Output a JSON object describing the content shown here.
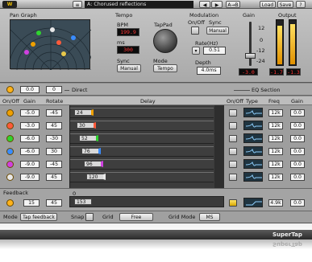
{
  "titlebar": {
    "preset": "A: Chorused reflections",
    "ab_label": "A→B",
    "load_label": "Load",
    "save_label": "Save",
    "help_label": "?"
  },
  "pan_graph": {
    "label": "Pan Graph"
  },
  "tempo": {
    "label": "Tempo",
    "bpm_label": "BPM",
    "bpm_value": "199.9",
    "ms_label": "ms",
    "ms_value": "300",
    "sync_label": "Sync",
    "sync_value": "Manual",
    "tap_label": "TapPad",
    "mode_label": "Mode",
    "mode_value": "Tempo"
  },
  "modulation": {
    "label": "Modulation",
    "onoff_label": "On/Off",
    "sync_label": "Sync",
    "sync_value": "Manual",
    "rate_label": "Rate(Hz)",
    "rate_value": "0.51",
    "depth_label": "Depth",
    "depth_value": "4.0ms"
  },
  "gain": {
    "label": "Gain",
    "scale": [
      "12",
      "0",
      "-12",
      "-24"
    ],
    "value": "-3.0"
  },
  "output": {
    "label": "Output",
    "left": "-1.7",
    "right": "-1.3"
  },
  "direct": {
    "label": "Direct",
    "gain": "0.0",
    "rotate": "0"
  },
  "eq_section": {
    "label": "EQ Section"
  },
  "headers": {
    "onoff": "On/Off",
    "gain": "Gain",
    "rotate": "Rotate",
    "delay": "Delay",
    "eq_onoff": "On/Off",
    "type": "Type",
    "freq": "Freq",
    "eq_gain": "Gain"
  },
  "taps": [
    {
      "gain": "-5.0",
      "rotate": "-45",
      "delay": "24",
      "freq": "12k",
      "eqgain": "0.0"
    },
    {
      "gain": "-3.0",
      "rotate": "45",
      "delay": "30",
      "freq": "12k",
      "eqgain": "0.0"
    },
    {
      "gain": "-6.0",
      "rotate": "-30",
      "delay": "52",
      "freq": "12k",
      "eqgain": "0.0"
    },
    {
      "gain": "-6.0",
      "rotate": "30",
      "delay": "76",
      "freq": "12k",
      "eqgain": "0.0"
    },
    {
      "gain": "-9.0",
      "rotate": "-45",
      "delay": "96",
      "freq": "12k",
      "eqgain": "0.0"
    },
    {
      "gain": "-9.0",
      "rotate": "45",
      "delay": "120",
      "freq": "12k",
      "eqgain": "0.0"
    }
  ],
  "feedback": {
    "label": "Feedback",
    "gain": "15",
    "rotate": "45",
    "delay": "153",
    "zero": "0",
    "freq": "4.9k",
    "eqgain": "0.0"
  },
  "bottom": {
    "mode_label": "Mode",
    "mode_value": "Tap feedback",
    "snap_label": "Snap",
    "grid_label": "Grid",
    "grid_value": "Free",
    "gridmode_label": "Grid Mode",
    "gridmode_value": "MS"
  },
  "brand": "SuperTap",
  "colors": {
    "tap1": "#f0a000",
    "tap2": "#ff5a3a",
    "tap3": "#2fd32f",
    "tap4": "#3a8cff",
    "tap5": "#d040e0",
    "tap6": "#e8e8e8",
    "lcd_text": "#ff3535"
  },
  "icons": [
    "menu-icon",
    "arrow-left-icon",
    "arrow-right-icon",
    "arrow-up-icon",
    "arrow-down-icon",
    "eq-curve-icon",
    "shelf-icon"
  ]
}
